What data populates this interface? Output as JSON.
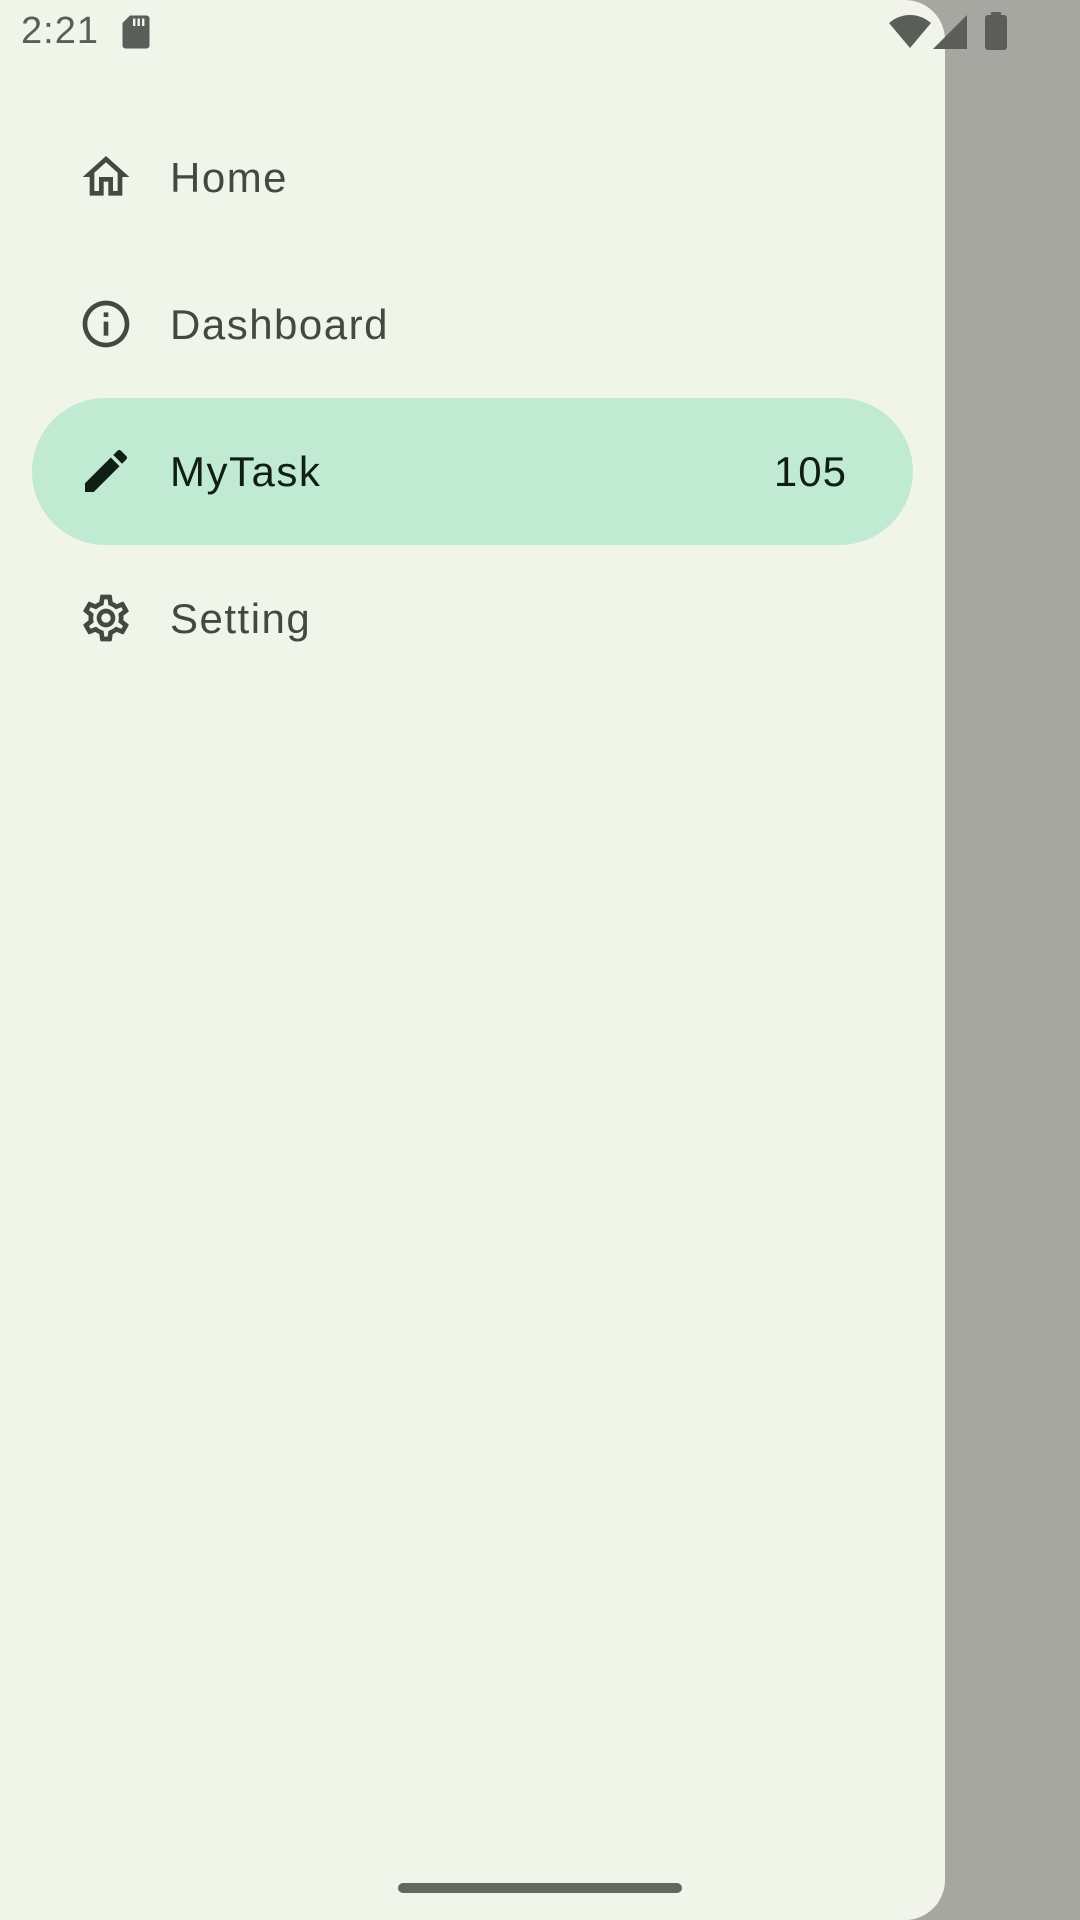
{
  "status_bar": {
    "time": "2:21",
    "icons": [
      "sd-card-icon",
      "wifi-icon",
      "signal-icon",
      "battery-icon"
    ]
  },
  "drawer": {
    "items": [
      {
        "label": "Home",
        "icon": "home-icon",
        "selected": false
      },
      {
        "label": "Dashboard",
        "icon": "info-icon",
        "selected": false
      },
      {
        "label": "MyTask",
        "icon": "pencil-icon",
        "selected": true,
        "badge": "105"
      },
      {
        "label": "Setting",
        "icon": "gear-icon",
        "selected": false
      }
    ]
  },
  "colors": {
    "drawer_bg": "#f0f4e9",
    "scrim": "#a6a7a0",
    "selected_bg": "#c1ead3",
    "text": "#444940",
    "selected_text": "#0f1f15"
  }
}
